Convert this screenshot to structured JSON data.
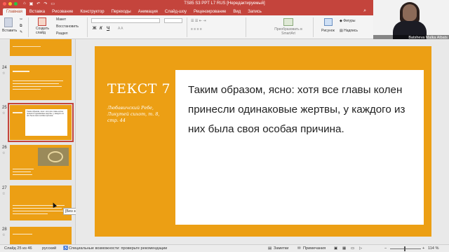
{
  "window": {
    "title": "TS85 S3 PPT L7 RUS [Нередактируемый]",
    "colors": {
      "accent": "#c4443c",
      "slide_orange": "#ec9f14"
    }
  },
  "ribbon_tabs": [
    "Главная",
    "Вставка",
    "Рисование",
    "Конструктор",
    "Переходы",
    "Анимация",
    "Слайд-шоу",
    "Рецензирование",
    "Вид",
    "Запись"
  ],
  "ribbon": {
    "paste_label": "Вставить",
    "new_slide_label": "Создать\nслайд",
    "layout_label": "Макет",
    "reset_label": "Восстановить",
    "section_label": "Раздел",
    "convert_label": "Преобразовать в SmartArt",
    "picture_label": "Рисунок",
    "shapes_label": "Фигуры",
    "textbox_label": "Надпись",
    "format_buttons": [
      "Ж",
      "К",
      "Ч"
    ]
  },
  "webcam": {
    "name": "Batsheva Malka Albats"
  },
  "thumbnails": [
    {
      "number": "24",
      "type": "text"
    },
    {
      "number": "25",
      "type": "selected-text",
      "text": "Таким образом, ясно: хотя все главы колен принесли одинаковые жертвы, у каждого из них была своя особая причина."
    },
    {
      "number": "26",
      "type": "photo"
    },
    {
      "number": "27",
      "type": "text"
    },
    {
      "number": "28",
      "type": "text"
    }
  ],
  "tooltip": "[Без заголовка]",
  "slide": {
    "heading": "ТЕКСТ 7",
    "source": "Любавичский Ребе, Ликутей сихот, т. 8, стр. 44",
    "body": "Таким образом, ясно: хотя все главы колен принесли одинаковые жертвы, у каждого из них была своя особая причина."
  },
  "status": {
    "slide_counter": "Слайд 25 из 46",
    "language": "русский",
    "accessibility": "Специальные возможности: проверьте рекомендации",
    "notes": "Заметки",
    "comments": "Примечания",
    "zoom": "114 %"
  }
}
